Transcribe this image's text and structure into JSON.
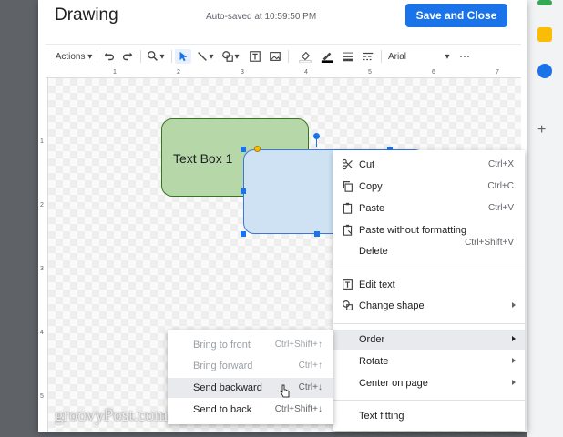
{
  "dialog": {
    "title": "Drawing",
    "autosave": "Auto-saved at 10:59:50 PM",
    "save_close_label": "Save and Close"
  },
  "toolbar": {
    "actions_label": "Actions",
    "font_name": "Arial",
    "icons": [
      "undo-icon",
      "redo-icon",
      "zoom-icon",
      "select-icon",
      "line-icon",
      "shape-icon",
      "textbox-icon",
      "image-icon",
      "fill-color-icon",
      "line-color-icon",
      "line-weight-icon",
      "line-dash-icon",
      "more-icon"
    ]
  },
  "ruler": {
    "top_numbers": [
      "1",
      "2",
      "3",
      "4",
      "5",
      "6",
      "7"
    ],
    "left_numbers": [
      "1",
      "2",
      "3",
      "4",
      "5"
    ]
  },
  "canvas": {
    "text_box_1": "Text Box 1"
  },
  "context_menu": {
    "items": [
      {
        "label": "Cut",
        "shortcut": "Ctrl+X",
        "icon": "scissors-icon"
      },
      {
        "label": "Copy",
        "shortcut": "Ctrl+C",
        "icon": "copy-icon"
      },
      {
        "label": "Paste",
        "shortcut": "Ctrl+V",
        "icon": "paste-icon"
      },
      {
        "label": "Paste without formatting",
        "shortcut": "Ctrl+Shift+V",
        "icon": "paste-plain-icon"
      },
      {
        "label": "Delete",
        "shortcut": "",
        "icon": ""
      },
      {
        "label": "Edit text",
        "shortcut": "",
        "icon": "edit-text-icon"
      },
      {
        "label": "Change shape",
        "shortcut": "",
        "icon": "change-shape-icon"
      },
      {
        "label": "Order",
        "shortcut": "",
        "icon": ""
      },
      {
        "label": "Rotate",
        "shortcut": "",
        "icon": ""
      },
      {
        "label": "Center on page",
        "shortcut": "",
        "icon": ""
      },
      {
        "label": "Text fitting",
        "shortcut": "",
        "icon": ""
      }
    ]
  },
  "order_submenu": {
    "items": [
      {
        "label": "Bring to front",
        "shortcut": "Ctrl+Shift+↑",
        "enabled": false
      },
      {
        "label": "Bring forward",
        "shortcut": "Ctrl+↑",
        "enabled": false
      },
      {
        "label": "Send backward",
        "shortcut": "Ctrl+↓",
        "enabled": true
      },
      {
        "label": "Send to back",
        "shortcut": "Ctrl+Shift+↓",
        "enabled": true
      }
    ]
  },
  "watermark": "groovyPost.com",
  "colors": {
    "accent": "#1a73e8",
    "green_fill": "#b6d7a8",
    "blue_fill": "#cfe2f3"
  }
}
